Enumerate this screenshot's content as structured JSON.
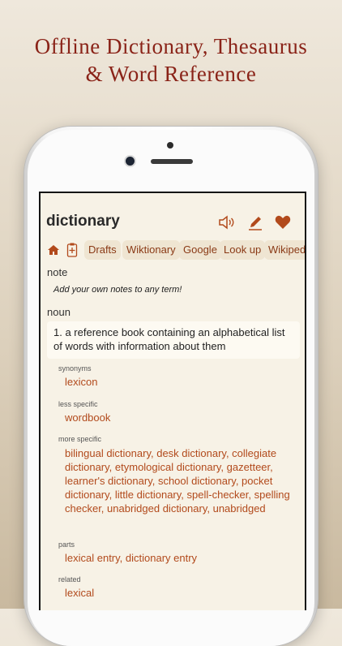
{
  "headline": {
    "line1": "Offline Dictionary, Thesaurus",
    "line2": "& Word Reference"
  },
  "colors": {
    "accent": "#b24a1c",
    "title": "#8a2318",
    "screen_bg": "#f7f2e6",
    "chip_bg": "#efe5d2"
  },
  "entry": {
    "word": "dictionary",
    "icons": [
      "speaker-icon",
      "pencil-icon",
      "heart-icon"
    ]
  },
  "tabs": {
    "icons": [
      "home-icon",
      "add-document-icon"
    ],
    "items": [
      "Drafts",
      "Wiktionary",
      "Google",
      "Look up",
      "Wikiped"
    ]
  },
  "note": {
    "header": "note",
    "placeholder": "Add your own notes to any term!"
  },
  "noun": {
    "header": "noun",
    "definition": "1. a reference book containing an alphabetical list of words with information about them",
    "synonyms": {
      "label": "synonyms",
      "value": "lexicon"
    },
    "less_specific": {
      "label": "less specific",
      "value": "wordbook"
    },
    "more_specific": {
      "label": "more specific",
      "value": "bilingual dictionary, desk dictionary, collegiate dictionary, etymological dictionary, gazetteer, learner's dictionary, school dictionary, pocket dictionary, little dictionary, spell-checker, spelling checker, unabridged dictionary, unabridged"
    },
    "parts": {
      "label": "parts",
      "value": "lexical entry, dictionary entry"
    },
    "related": {
      "label": "related",
      "value": "lexical"
    }
  }
}
